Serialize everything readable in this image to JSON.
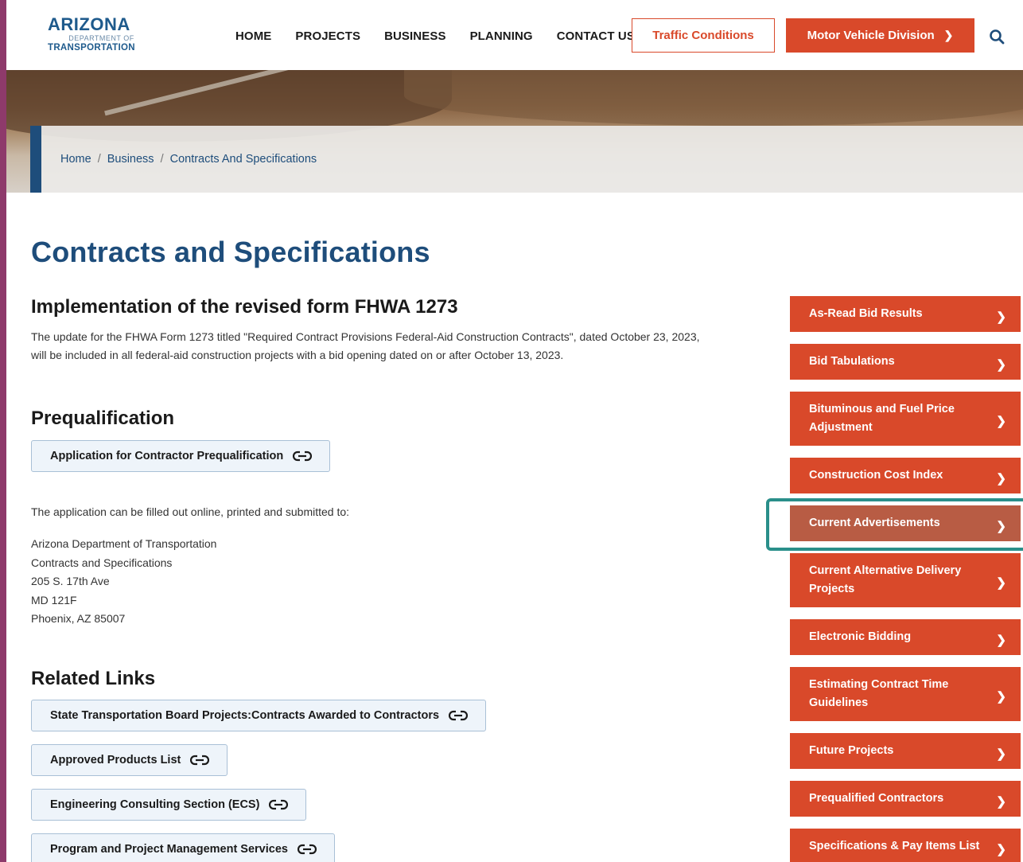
{
  "header": {
    "logo": {
      "line1": "ARIZONA",
      "line2": "DEPARTMENT OF",
      "line3": "TRANSPORTATION"
    },
    "nav": [
      "HOME",
      "PROJECTS",
      "BUSINESS",
      "PLANNING",
      "CONTACT US"
    ],
    "traffic_label": "Traffic Conditions",
    "mvd_label": "Motor Vehicle Division",
    "search_icon": "search-icon"
  },
  "breadcrumb": {
    "items": [
      "Home",
      "Business",
      "Contracts And Specifications"
    ],
    "separator": "/"
  },
  "page_title": "Contracts and Specifications",
  "sections": {
    "fhwa": {
      "heading": "Implementation of the revised form FHWA 1273",
      "body_line1": "The update for the FHWA Form 1273 titled \"Required Contract Provisions Federal-Aid Construction Contracts\", dated October 23, 2023,",
      "body_line2": "will be included in all federal-aid construction projects with a bid opening dated on or after October 13, 2023."
    },
    "prequal": {
      "heading": "Prequalification",
      "link_label": "Application for Contractor Prequalification",
      "note": "The application can be filled out online, printed and submitted to:",
      "address": [
        "Arizona Department of Transportation",
        "Contracts and Specifications",
        "205 S. 17th Ave",
        "MD 121F",
        "Phoenix, AZ 85007"
      ]
    },
    "related": {
      "heading": "Related Links",
      "links": [
        "State Transportation Board Projects:Contracts Awarded to Contractors",
        "Approved Products List",
        "Engineering Consulting Section (ECS)",
        "Program and Project Management Services"
      ]
    }
  },
  "sidebar": {
    "items": [
      {
        "label": "As-Read Bid Results"
      },
      {
        "label": "Bid Tabulations"
      },
      {
        "label": "Bituminous and Fuel Price Adjustment"
      },
      {
        "label": "Construction Cost Index"
      },
      {
        "label": "Current Advertisements"
      },
      {
        "label": "Current Alternative Delivery Projects"
      },
      {
        "label": "Electronic Bidding"
      },
      {
        "label": "Estimating Contract Time Guidelines"
      },
      {
        "label": "Future Projects"
      },
      {
        "label": "Prequalified Contractors"
      },
      {
        "label": "Specifications & Pay Items List"
      }
    ]
  },
  "colors": {
    "brand_orange": "#d9492a",
    "brand_blue": "#1e4d7b",
    "active_item": "#b85c44",
    "focus_outline": "#2a8f8a",
    "frame": "#8e3a6b"
  }
}
